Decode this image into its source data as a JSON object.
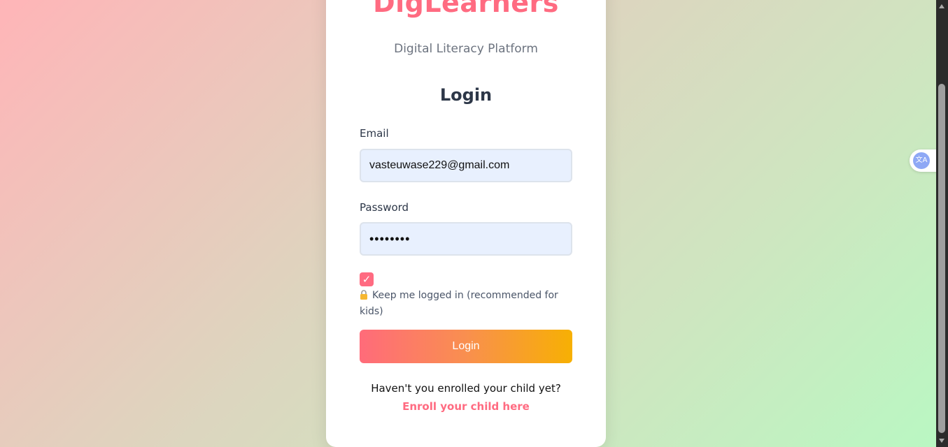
{
  "brand": {
    "name": "DigLearners",
    "tagline": "Digital Literacy Platform"
  },
  "login": {
    "heading": "Login",
    "email_label": "Email",
    "email_value": "vasteuwase229@gmail.com",
    "password_label": "Password",
    "password_value": "••••••••",
    "remember_checked": true,
    "remember_check_glyph": "✓",
    "remember_label": "Keep me logged in (recommended for kids)",
    "remember_icon": "lock-icon",
    "submit_label": "Login"
  },
  "enroll": {
    "question": "Haven't you enrolled your child yet?",
    "link_label": "Enroll your child here"
  },
  "translate_widget": {
    "icon": "translate-icon",
    "glyph": "文A"
  },
  "colors": {
    "brand": "#ff6b81",
    "button_start": "#ff6b7a",
    "button_end": "#f7b003",
    "input_bg": "#e8f0fe"
  }
}
